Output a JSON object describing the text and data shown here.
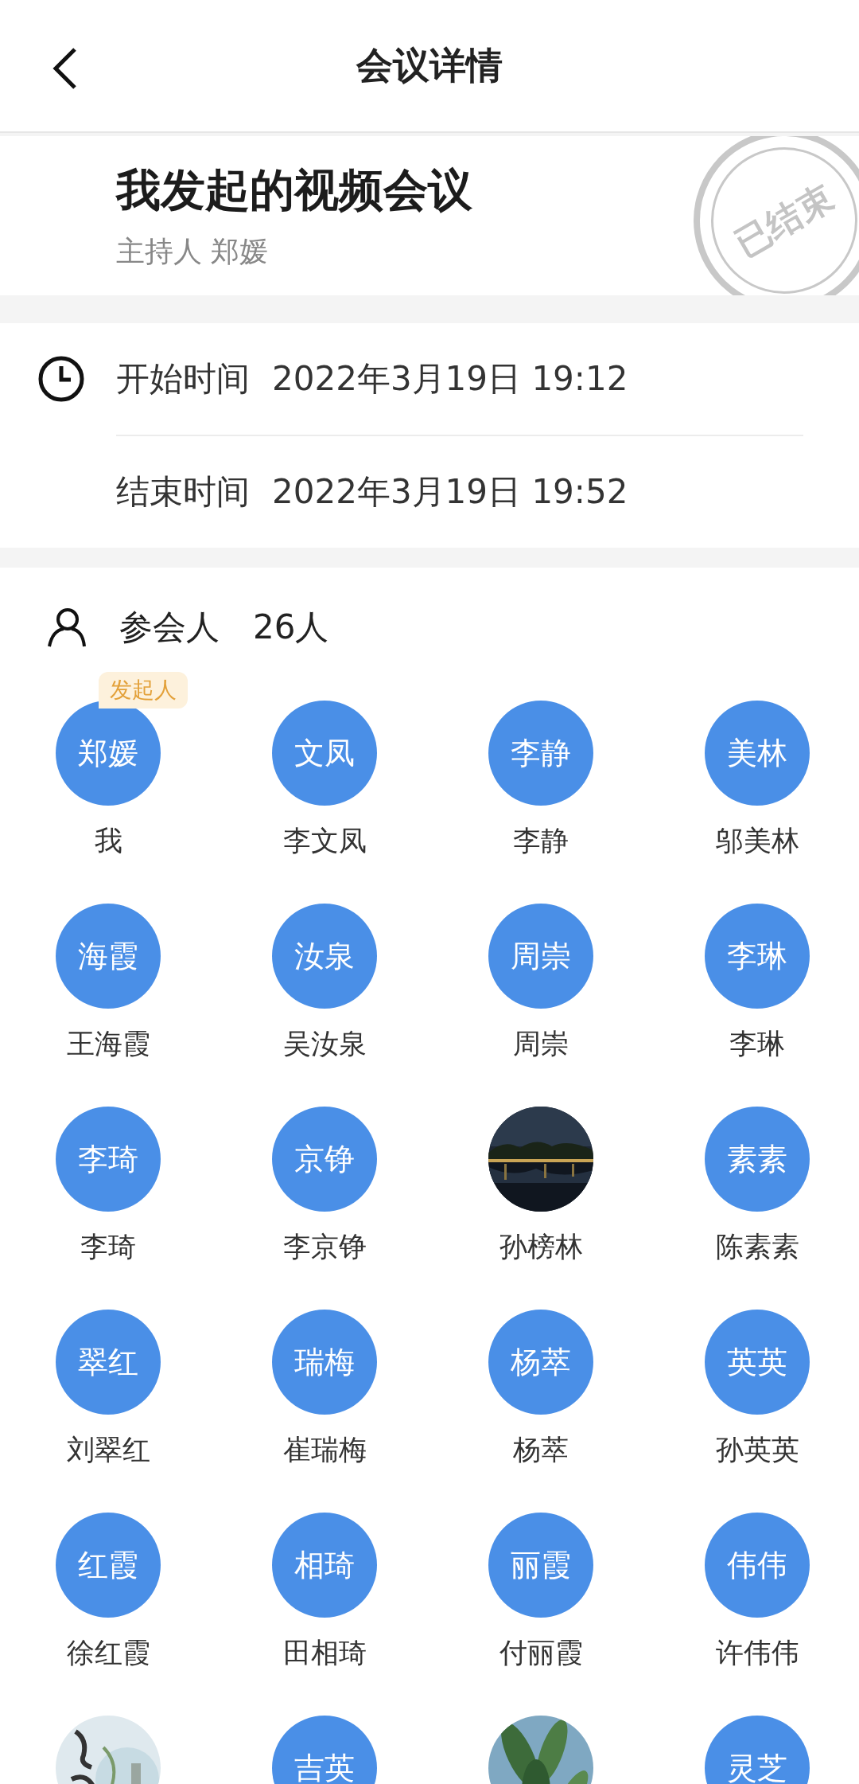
{
  "header": {
    "title": "会议详情"
  },
  "meeting": {
    "title": "我发起的视频会议",
    "host": "主持人 郑媛",
    "stamp": "已结束"
  },
  "times": [
    {
      "kind": "start",
      "label": "开始时间",
      "value": "2022年3月19日 19:12"
    },
    {
      "kind": "end",
      "label": "结束时间",
      "value": "2022年3月19日 19:52"
    }
  ],
  "participants_header": {
    "label": "参会人",
    "count": "26人"
  },
  "participants": [
    {
      "kind": "text",
      "avatar_text": "郑媛",
      "name": "我",
      "badge": "发起人"
    },
    {
      "kind": "text",
      "avatar_text": "文凤",
      "name": "李文凤"
    },
    {
      "kind": "text",
      "avatar_text": "李静",
      "name": "李静"
    },
    {
      "kind": "text",
      "avatar_text": "美林",
      "name": "邬美林"
    },
    {
      "kind": "text",
      "avatar_text": "海霞",
      "name": "王海霞"
    },
    {
      "kind": "text",
      "avatar_text": "汝泉",
      "name": "吴汝泉"
    },
    {
      "kind": "text",
      "avatar_text": "周崇",
      "name": "周崇"
    },
    {
      "kind": "text",
      "avatar_text": "李琳",
      "name": "李琳"
    },
    {
      "kind": "text",
      "avatar_text": "李琦",
      "name": "李琦"
    },
    {
      "kind": "text",
      "avatar_text": "京铮",
      "name": "李京铮"
    },
    {
      "kind": "picture",
      "name": "孙榜林"
    },
    {
      "kind": "text",
      "avatar_text": "素素",
      "name": "陈素素"
    },
    {
      "kind": "text",
      "avatar_text": "翠红",
      "name": "刘翠红"
    },
    {
      "kind": "text",
      "avatar_text": "瑞梅",
      "name": "崔瑞梅"
    },
    {
      "kind": "text",
      "avatar_text": "杨萃",
      "name": "杨萃"
    },
    {
      "kind": "text",
      "avatar_text": "英英",
      "name": "孙英英"
    },
    {
      "kind": "text",
      "avatar_text": "红霞",
      "name": "徐红霞"
    },
    {
      "kind": "text",
      "avatar_text": "相琦",
      "name": "田相琦"
    },
    {
      "kind": "text",
      "avatar_text": "丽霞",
      "name": "付丽霞"
    },
    {
      "kind": "text",
      "avatar_text": "伟伟",
      "name": "许伟伟"
    },
    {
      "kind": "picture"
    },
    {
      "kind": "text",
      "avatar_text": "吉英"
    },
    {
      "kind": "picture"
    },
    {
      "kind": "text",
      "avatar_text": "灵芝"
    }
  ]
}
